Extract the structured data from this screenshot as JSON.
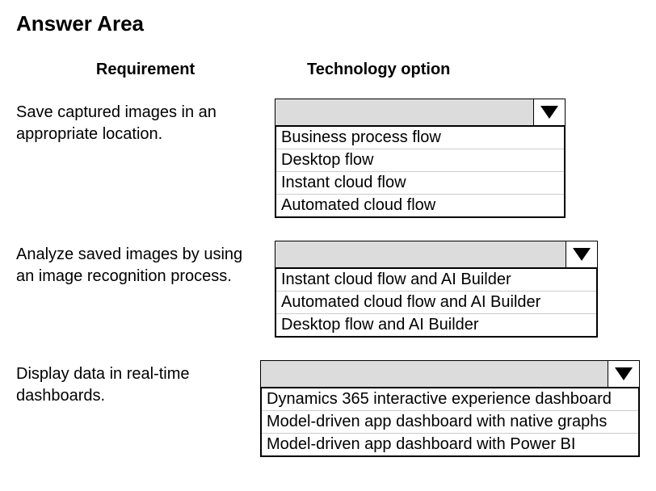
{
  "title": "Answer Area",
  "headers": {
    "requirement": "Requirement",
    "technology": "Technology option"
  },
  "rows": [
    {
      "requirement": "Save captured images in an appropriate location.",
      "dropdown_width": 360,
      "options_width": 360,
      "options": [
        "Business process flow",
        "Desktop flow",
        "Instant cloud flow",
        "Automated cloud flow"
      ]
    },
    {
      "requirement": "Analyze saved images by using an image recognition process.",
      "dropdown_width": 400,
      "options_width": 400,
      "options": [
        "Instant cloud flow and AI Builder",
        "Automated cloud flow and AI Builder",
        "Desktop flow and AI Builder"
      ]
    },
    {
      "requirement": "Display data in real-time dashboards.",
      "dropdown_width": 470,
      "options_width": 470,
      "options": [
        "Dynamics 365 interactive experience dashboard",
        "Model-driven app dashboard with native graphs",
        "Model-driven app dashboard with Power BI"
      ]
    }
  ]
}
